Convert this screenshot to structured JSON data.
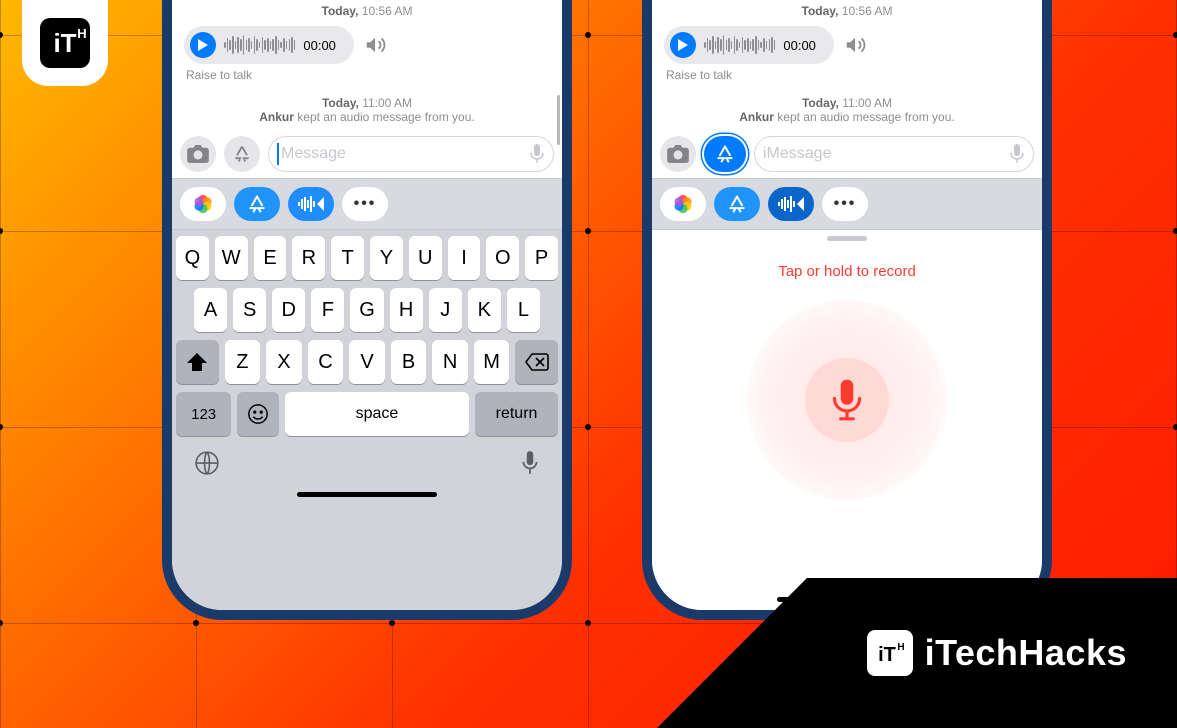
{
  "brand": {
    "name": "iTechHacks"
  },
  "message": {
    "timestamp1_label": "Today,",
    "timestamp1_time": "10:56 AM",
    "audio_duration": "00:00",
    "hint": "Raise to talk",
    "timestamp2_label": "Today,",
    "timestamp2_time": "11:00 AM",
    "kept_name": "Ankur",
    "kept_text": " kept an audio message from you."
  },
  "input": {
    "placeholder_left": "Message",
    "placeholder_right": "iMessage"
  },
  "apps": {
    "more": "•••"
  },
  "keyboard": {
    "row1": [
      "Q",
      "W",
      "E",
      "R",
      "T",
      "Y",
      "U",
      "I",
      "O",
      "P"
    ],
    "row2": [
      "A",
      "S",
      "D",
      "F",
      "G",
      "H",
      "J",
      "K",
      "L"
    ],
    "row3": [
      "Z",
      "X",
      "C",
      "V",
      "B",
      "N",
      "M"
    ],
    "num": "123",
    "space": "space",
    "return": "return"
  },
  "record": {
    "hint": "Tap or hold to record"
  }
}
